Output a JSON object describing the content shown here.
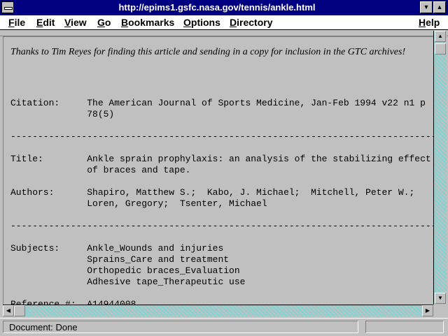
{
  "window": {
    "title": "http://epims1.gsfc.nasa.gov/tennis/ankle.html"
  },
  "menu": {
    "items": [
      {
        "first": "F",
        "rest": "ile"
      },
      {
        "first": "E",
        "rest": "dit"
      },
      {
        "first": "V",
        "rest": "iew"
      },
      {
        "first": "G",
        "rest": "o"
      },
      {
        "first": "B",
        "rest": "ookmarks"
      },
      {
        "first": "O",
        "rest": "ptions"
      },
      {
        "first": "D",
        "rest": "irectory"
      },
      {
        "first": "H",
        "rest": "elp"
      }
    ]
  },
  "content": {
    "intro": "Thanks to Tim Reyes for finding this article and sending in a copy for inclusion in the GTC archives!",
    "citation": "Citation:     The American Journal of Sports Medicine, Jan-Feb 1994 v22 n1 p\n              78(5)",
    "separator": "------------------------------------------------------------------------------------------",
    "title_block": "Title:        Ankle sprain prophylaxis: an analysis of the stabilizing effect\n              of braces and tape.",
    "authors_block": "Authors:      Shapiro, Matthew S.;  Kabo, J. Michael;  Mitchell, Peter W.;\n              Loren, Gregory;  Tsenter, Michael",
    "subjects_block": "Subjects:     Ankle_Wounds and injuries\n              Sprains_Care and treatment\n              Orthopedic braces_Evaluation\n              Adhesive tape_Therapeutic use",
    "reference": "Reference #:  A14944008"
  },
  "status": {
    "text": "Document: Done"
  },
  "icons": {
    "up": "▲",
    "down": "▼",
    "left": "◀",
    "right": "▶",
    "minimize": "▼",
    "maximize": "▲"
  }
}
